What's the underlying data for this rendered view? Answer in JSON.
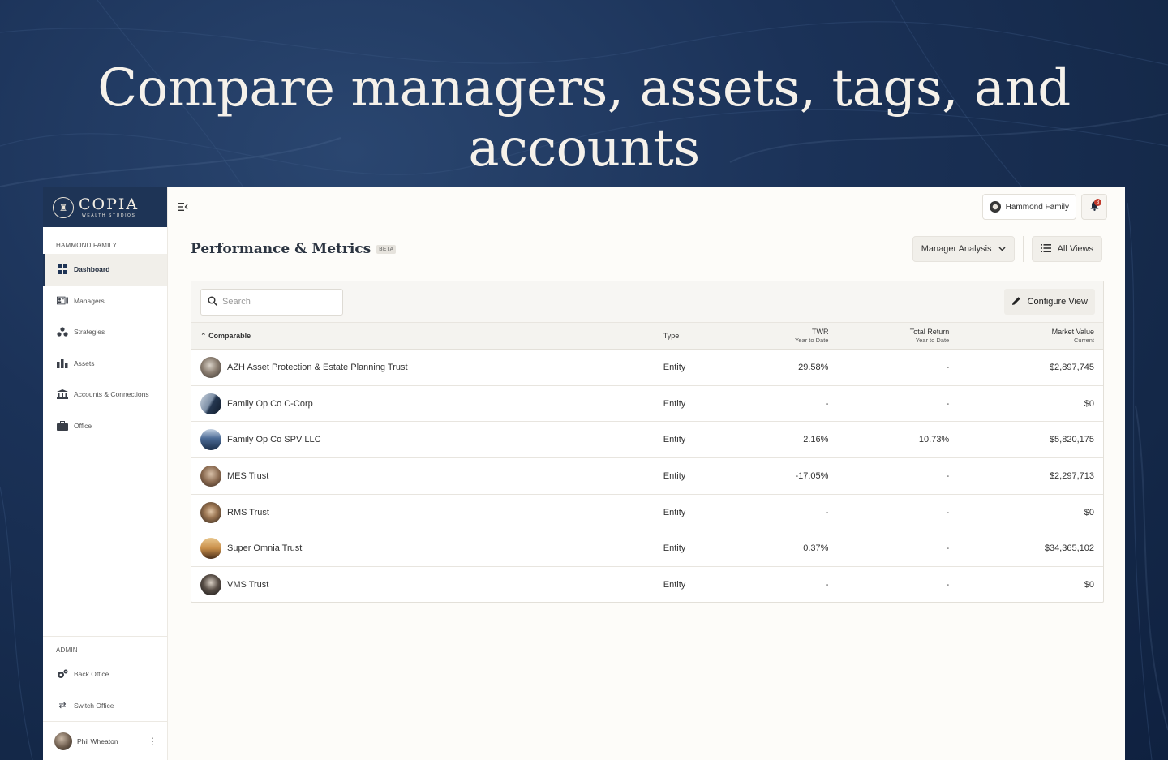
{
  "hero": {
    "title": "Compare managers, assets, tags, and accounts"
  },
  "brand": {
    "name": "COPIA",
    "subtitle": "WEALTH STUDIOS"
  },
  "sidebar": {
    "section_label": "HAMMOND FAMILY",
    "items": [
      {
        "label": "Dashboard",
        "icon": "grid-icon",
        "active": true
      },
      {
        "label": "Managers",
        "icon": "id-card-icon"
      },
      {
        "label": "Strategies",
        "icon": "shapes-icon"
      },
      {
        "label": "Assets",
        "icon": "bar-chart-icon"
      },
      {
        "label": "Accounts & Connections",
        "icon": "bank-icon"
      },
      {
        "label": "Office",
        "icon": "briefcase-icon"
      }
    ],
    "admin_label": "ADMIN",
    "admin_items": [
      {
        "label": "Back Office",
        "icon": "gears-icon"
      },
      {
        "label": "Switch Office",
        "icon": "swap-icon"
      }
    ],
    "user": {
      "name": "Phil Wheaton"
    }
  },
  "topbar": {
    "family_label": "Hammond Family",
    "notifications_count": "3"
  },
  "header": {
    "title": "Performance & Metrics",
    "badge": "BETA",
    "analysis_select": "Manager Analysis",
    "views_button": "All Views"
  },
  "table": {
    "search_placeholder": "Search",
    "configure_label": "Configure View",
    "columns": {
      "comparable": "Comparable",
      "type": "Type",
      "twr": "TWR",
      "twr_sub": "Year to Date",
      "total_return": "Total Return",
      "total_return_sub": "Year to Date",
      "market_value": "Market Value",
      "market_value_sub": "Current"
    },
    "rows": [
      {
        "name": "AZH Asset Protection & Estate Planning Trust",
        "type": "Entity",
        "twr": "29.58%",
        "total_return": "-",
        "market_value": "$2,897,745"
      },
      {
        "name": "Family Op Co C-Corp",
        "type": "Entity",
        "twr": "-",
        "total_return": "-",
        "market_value": "$0"
      },
      {
        "name": "Family Op Co SPV LLC",
        "type": "Entity",
        "twr": "2.16%",
        "total_return": "10.73%",
        "market_value": "$5,820,175"
      },
      {
        "name": "MES Trust",
        "type": "Entity",
        "twr": "-17.05%",
        "total_return": "-",
        "market_value": "$2,297,713"
      },
      {
        "name": "RMS Trust",
        "type": "Entity",
        "twr": "-",
        "total_return": "-",
        "market_value": "$0"
      },
      {
        "name": "Super Omnia Trust",
        "type": "Entity",
        "twr": "0.37%",
        "total_return": "-",
        "market_value": "$34,365,102"
      },
      {
        "name": "VMS Trust",
        "type": "Entity",
        "twr": "-",
        "total_return": "-",
        "market_value": "$0"
      }
    ]
  },
  "colors": {
    "brand_navy": "#1e3456",
    "background": "#fdfcf9"
  }
}
